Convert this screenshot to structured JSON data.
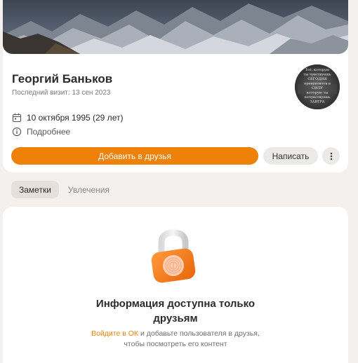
{
  "profile": {
    "name": "Георгий Баньков",
    "last_visit": "Последний визит: 13 сен 2023",
    "birthday": "10 октября 1995 (29 лет)",
    "details_link": "Подробнее",
    "add_friend_button": "Добавить в друзья",
    "message_button": "Написать",
    "more_icon": "more-vertical-icon",
    "avatar_text": [
      "Тот, которую",
      "ты чувствуешь",
      "СЕГОДНЯ",
      "превратится в",
      "СИЛУ",
      "которую ты",
      "почувствуешь",
      "ЗАВТРА"
    ]
  },
  "tabs": [
    {
      "label": "Заметки",
      "active": true
    },
    {
      "label": "Увлечения",
      "active": false
    }
  ],
  "locked": {
    "title_line1": "Информация доступна только",
    "title_line2": "друзьям",
    "login_link": "Войдите в ОК",
    "desc_rest": " и добавьте пользователя в друзья,",
    "desc_line2": "чтобы посмотреть его контент",
    "lock_icon": "lock-icon"
  },
  "colors": {
    "accent": "#ee8208",
    "background": "#f3f0ed",
    "card": "#ffffff"
  }
}
